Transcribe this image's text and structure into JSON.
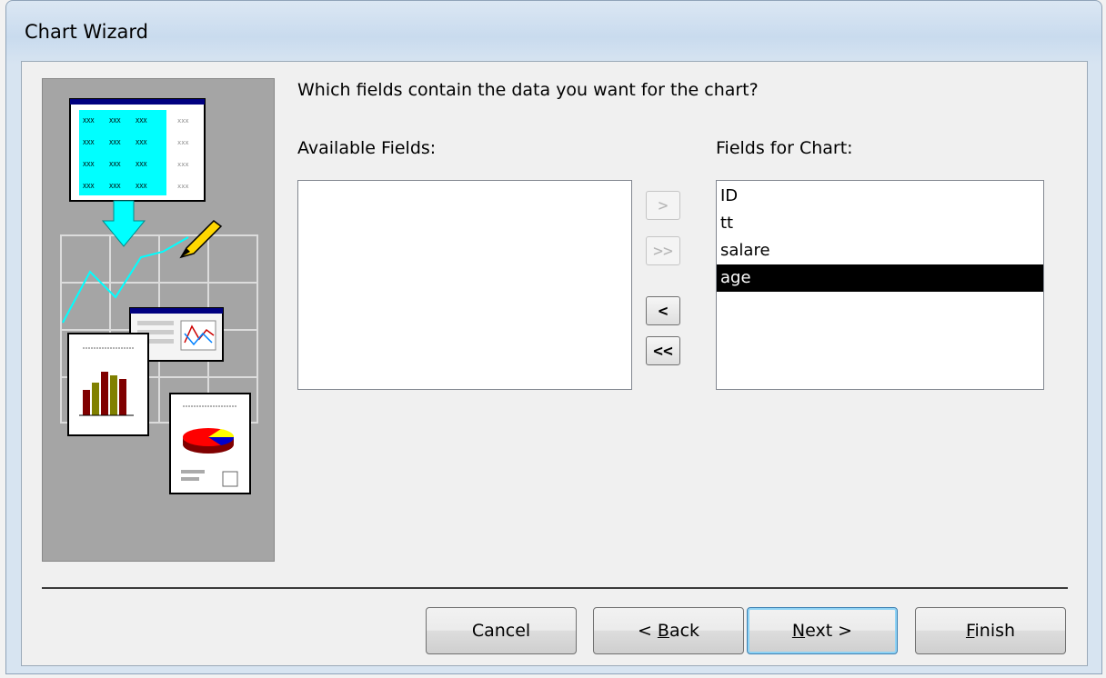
{
  "window": {
    "title": "Chart Wizard"
  },
  "question": "Which fields contain the data you want for the chart?",
  "available": {
    "label": "Available Fields:",
    "items": []
  },
  "chart_fields": {
    "label": "Fields for Chart:",
    "items": [
      "ID",
      "tt",
      "salare",
      "age"
    ],
    "selected": "age"
  },
  "move_buttons": {
    "add_one": ">",
    "add_all": ">>",
    "remove_one": "<",
    "remove_all": "<<"
  },
  "buttons": {
    "cancel": "Cancel",
    "back_prefix": "< ",
    "back_key": "B",
    "back_rest": "ack",
    "next_key": "N",
    "next_rest": "ext >",
    "finish_key": "F",
    "finish_rest": "inish"
  },
  "illustration": {
    "cell_text": "XXX"
  },
  "colors": {
    "selection": "#000000",
    "accent_cyan": "#00ffff",
    "panel": "#a5a5a5"
  }
}
